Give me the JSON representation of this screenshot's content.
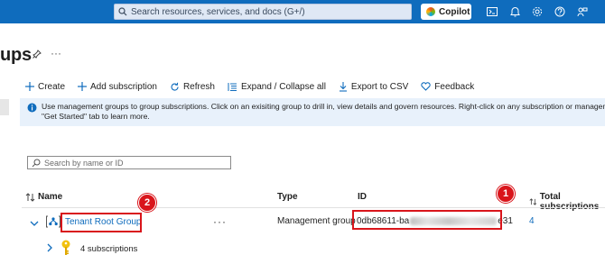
{
  "topbar": {
    "search_placeholder": "Search resources, services, and docs (G+/)",
    "copilot_label": "Copilot"
  },
  "page": {
    "title": "ups",
    "more": "···"
  },
  "toolbar": {
    "create": "Create",
    "add_subscription": "Add subscription",
    "refresh": "Refresh",
    "expand_collapse": "Expand / Collapse all",
    "export_csv": "Export to CSV",
    "feedback": "Feedback"
  },
  "banner": {
    "line1": "Use management groups to group subscriptions. Click on an exisiting group to drill in, view details and govern resources. Right-click on any subscription or management group to launch q",
    "line2": "\"Get Started\" tab to learn more."
  },
  "filter": {
    "placeholder": "Search by name or ID"
  },
  "table": {
    "columns": {
      "name": "Name",
      "type": "Type",
      "id": "ID",
      "total": "Total subscriptions"
    },
    "rows": [
      {
        "name": "Tenant Root Group",
        "actions": "···",
        "type": "Management group",
        "id_prefix": "0db68611-ba",
        "id_suffix": "e31",
        "total": "4"
      }
    ],
    "child": {
      "label": "4 subscriptions"
    }
  },
  "annotations": {
    "badge1": "1",
    "badge2": "2"
  },
  "colors": {
    "accent": "#0f6cbd",
    "annotation": "#d9151b",
    "banner_bg": "#e8f1fb"
  }
}
